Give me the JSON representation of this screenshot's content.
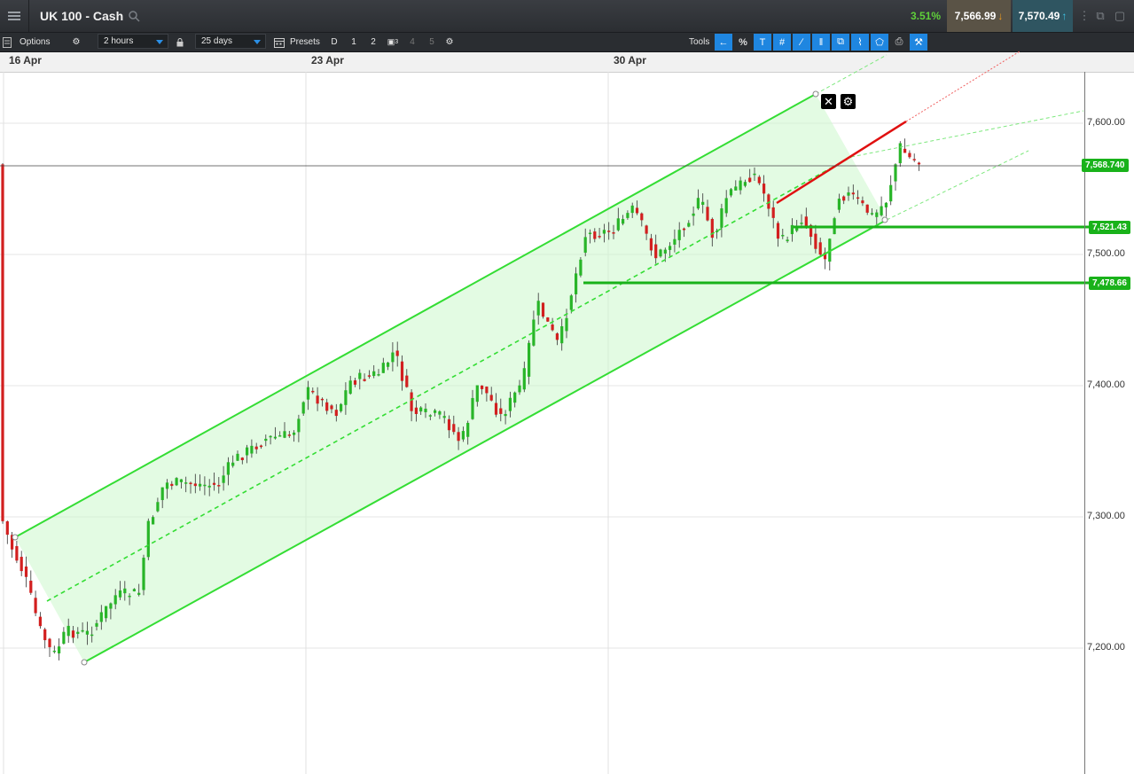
{
  "header": {
    "title": "UK 100 - Cash",
    "change_pct": "3.51%",
    "sell_price": "7,566.99",
    "buy_price": "7,570.49"
  },
  "toolbar": {
    "options_label": "Options",
    "interval": "2 hours",
    "range": "25 days",
    "presets_label": "Presets",
    "presets": [
      "D",
      "1",
      "2",
      "3",
      "4",
      "5"
    ],
    "tools_label": "Tools"
  },
  "dates": [
    "16 Apr",
    "23 Apr",
    "30 Apr"
  ],
  "price_axis": [
    "7,600.00",
    "7,500.00",
    "7,400.00",
    "7,300.00",
    "7,200.00"
  ],
  "price_tags": {
    "current": "7,568.740",
    "level_1": "7,521.43",
    "level_2": "7,478.66"
  },
  "colors": {
    "up": "#28b528",
    "down": "#d21f1f",
    "channel": "#34dd34",
    "red_line": "#e01010"
  },
  "icons": [
    "menu-icon",
    "search-icon",
    "down-arrow-icon",
    "up-arrow-icon",
    "gear-icon",
    "lock-icon",
    "calendar-icon",
    "close-icon"
  ]
}
